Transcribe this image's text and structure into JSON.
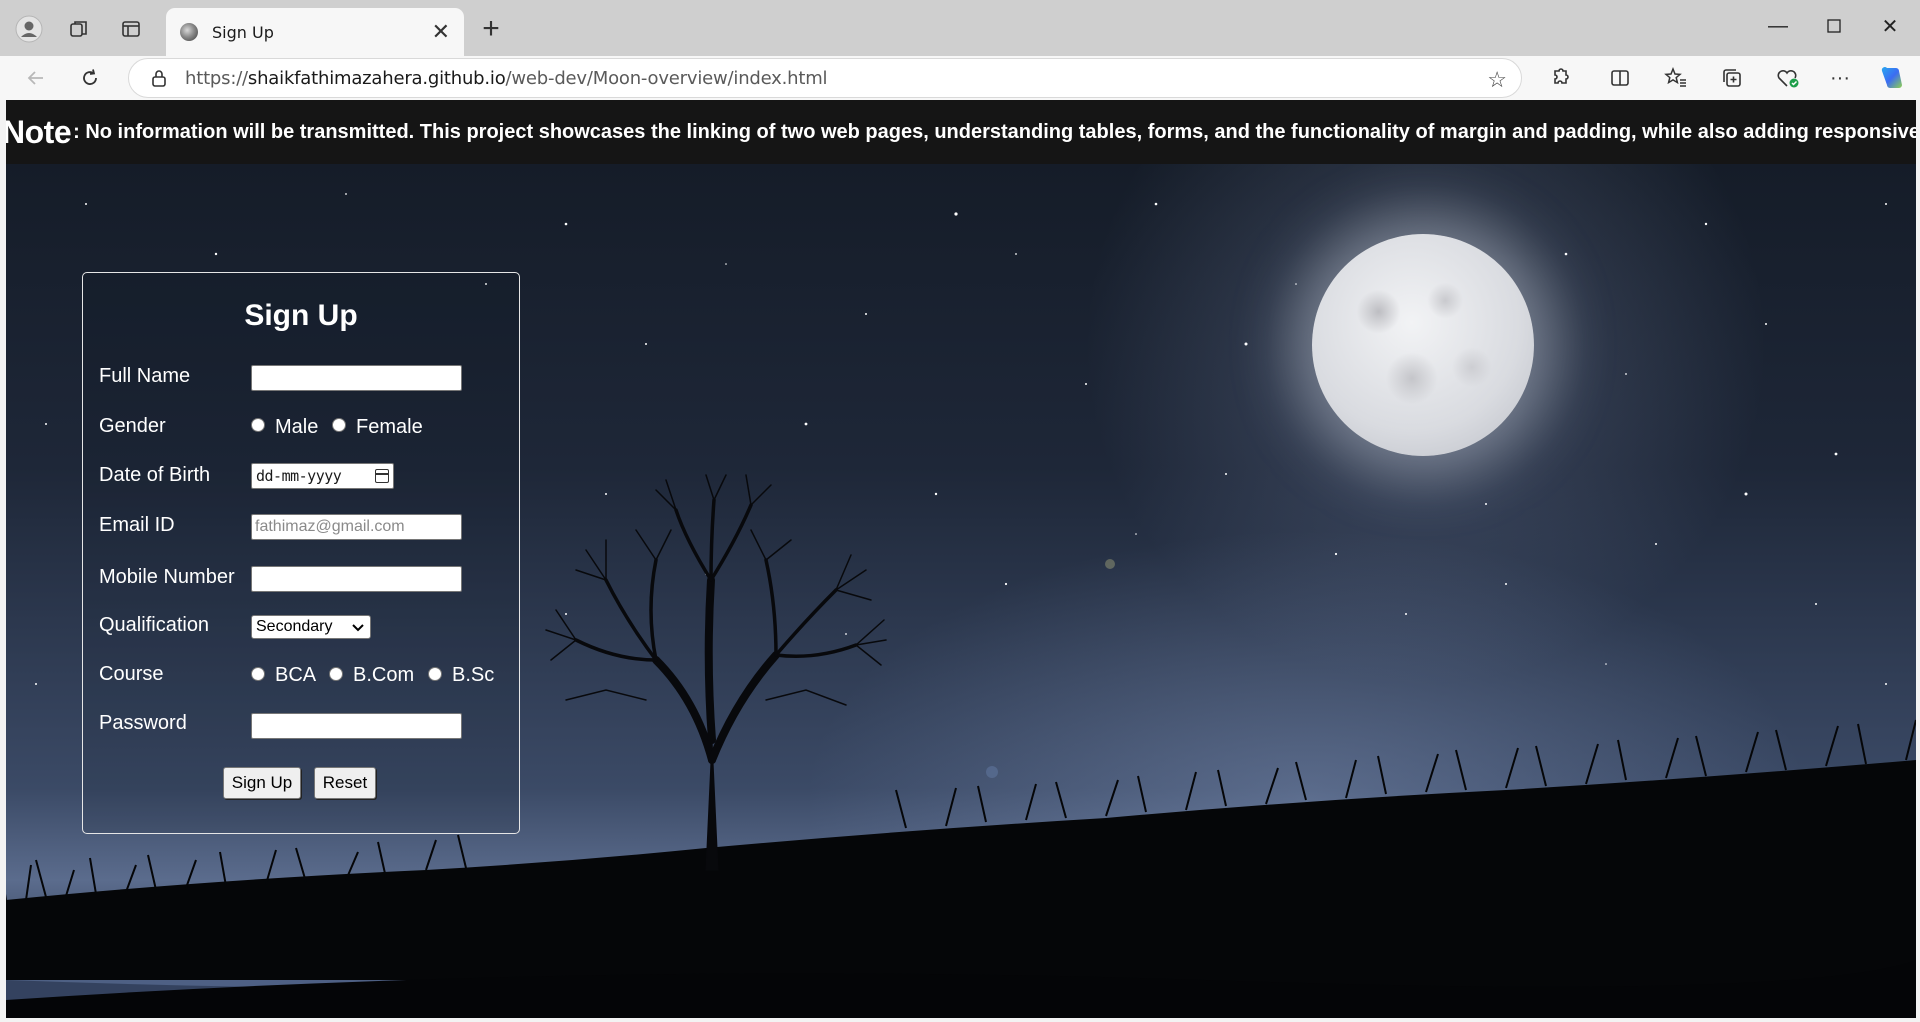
{
  "browser": {
    "tab_title": "Sign Up",
    "url_scheme": "https://",
    "url_host": "shaikfathimazahera.github.io",
    "url_path": "/web-dev/Moon-overview/index.html"
  },
  "page": {
    "note_label": "Note",
    "note_text": ": No information will be transmitted. This project showcases the linking of two web pages, understanding tables, forms, and the functionality of margin and padding, while also adding responsiveness."
  },
  "form": {
    "title": "Sign Up",
    "full_name_label": "Full Name",
    "gender_label": "Gender",
    "gender_options": [
      "Male",
      "Female"
    ],
    "dob_label": "Date of Birth",
    "dob_placeholder": "dd-mm-yyyy",
    "email_label": "Email ID",
    "email_placeholder": "fathimaz@gmail.com",
    "mobile_label": "Mobile Number",
    "qualification_label": "Qualification",
    "qualification_value": "Secondary",
    "course_label": "Course",
    "course_options": [
      "BCA",
      "B.Com",
      "B.Sc"
    ],
    "password_label": "Password",
    "submit_label": "Sign Up",
    "reset_label": "Reset"
  },
  "colors": {
    "note_bar": "#151515",
    "sky_top": "#131a25",
    "sky_horizon": "#5b6c8d",
    "moon": "#e6e8ec"
  },
  "icons": [
    "profile-icon",
    "workspaces-icon",
    "tab-actions-icon",
    "back-icon",
    "refresh-icon",
    "lock-icon",
    "favorite-star-icon",
    "extensions-icon",
    "split-screen-icon",
    "favorites-icon",
    "collections-icon",
    "browser-essentials-icon",
    "more-icon",
    "copilot-icon",
    "minimize-icon",
    "maximize-icon",
    "close-window-icon"
  ]
}
